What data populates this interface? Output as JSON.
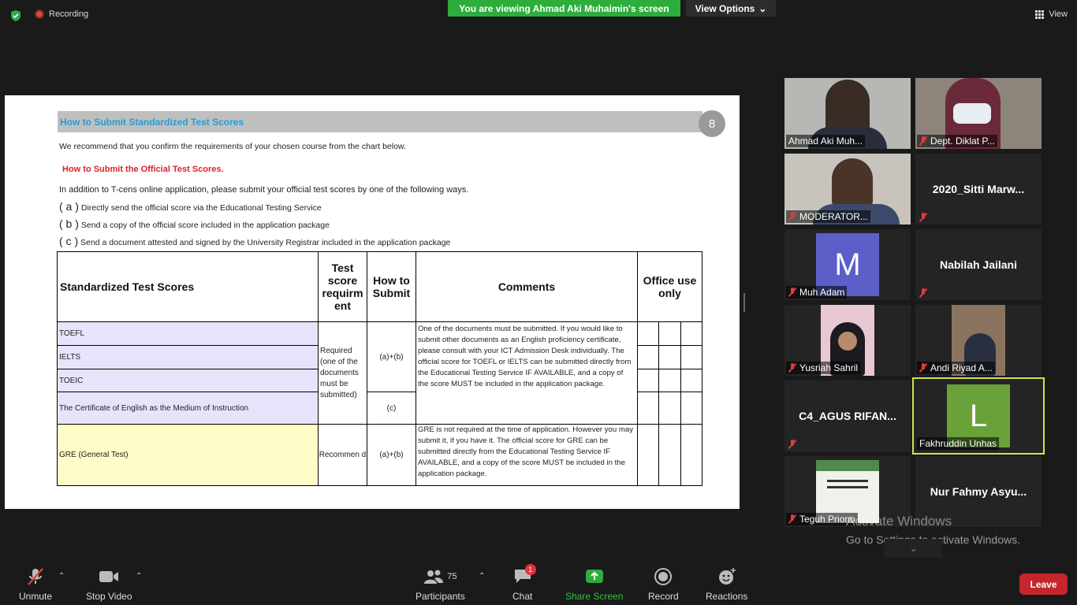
{
  "topbar": {
    "recording_label": "Recording",
    "viewing_label": "You are viewing Ahmad Aki Muhaimin's screen",
    "view_options_label": "View Options",
    "view_label": "View",
    "accent_green": "#2dad3c"
  },
  "document": {
    "title": "How to Submit Standardized Test Scores",
    "page_number": "8",
    "intro": "We recommend that you confirm the requirements of your chosen course from the chart below.",
    "red_heading": "How to Submit the Official Test Scores.",
    "para": "In addition to T-cens online application, please submit your official test scores by one of the following ways.",
    "options": [
      {
        "letter": "( a )",
        "text": "Directly send the official score via the Educational Testing Service"
      },
      {
        "letter": "( b )",
        "text": "Send a copy of the official score included in the application package"
      },
      {
        "letter": "( c )",
        "text": "Send a document attested and signed by the University Registrar included in the application package"
      }
    ],
    "table": {
      "headers": [
        "Standardized Test Scores",
        "Test score requirm ent",
        "How to Submit",
        "Comments",
        "Office use only"
      ],
      "rows": [
        "TOEFL",
        "IELTS",
        "TOEIC",
        "The Certificate of English as the Medium of Instruction",
        "GRE (General Test)"
      ],
      "requirement_1": "Required (one of the documents must be submitted)",
      "requirement_2": "Recommen d",
      "how_1": "(a)+(b)",
      "how_2": "(c)",
      "how_3": "(a)+(b)",
      "comment_1": "One of the documents must be submitted. If you would like to submit other documents as an English proficiency certificate, please consult with your ICT Admission Desk individually. The official score for TOEFL or IELTS can be submitted directly from the Educational Testing Service IF AVAILABLE, and a copy of the score MUST be included in the application package.",
      "comment_2": "GRE is not required at the time of application. However you may submit it, if you have it. The official score for GRE can be submitted directly from the Educational Testing Service IF AVAILABLE, and a copy of the score MUST be included in the application package."
    }
  },
  "participants": [
    {
      "name": "Ahmad Aki Muh...",
      "type": "video"
    },
    {
      "name": "Dept. Diklat P...",
      "type": "video"
    },
    {
      "name": "MODERATOR...",
      "type": "video"
    },
    {
      "name": "2020_Sitti  Marw...",
      "type": "text"
    },
    {
      "name": "Muh Adam",
      "type": "avatar",
      "initial": "M",
      "color": "#5b5fc7"
    },
    {
      "name": "Nabilah Jailani",
      "type": "text"
    },
    {
      "name": "Yusriah Sahril",
      "type": "video"
    },
    {
      "name": "Andi Riyad A...",
      "type": "video"
    },
    {
      "name": "C4_AGUS  RIFAN...",
      "type": "text"
    },
    {
      "name": "Fakhruddin Unhas",
      "type": "avatar",
      "initial": "L",
      "color": "#6aa23a"
    },
    {
      "name": "Teguh Priono",
      "type": "image"
    },
    {
      "name": "Nur Fahmy  Asyu...",
      "type": "text"
    }
  ],
  "watermark": {
    "line1": "Activate Windows",
    "line2": "Go to Settings to activate Windows."
  },
  "toolbar": {
    "unmute": "Unmute",
    "stop_video": "Stop Video",
    "participants": "Participants",
    "participants_count": "75",
    "chat": "Chat",
    "chat_badge": "1",
    "share_screen": "Share Screen",
    "record": "Record",
    "reactions": "Reactions",
    "leave": "Leave"
  }
}
